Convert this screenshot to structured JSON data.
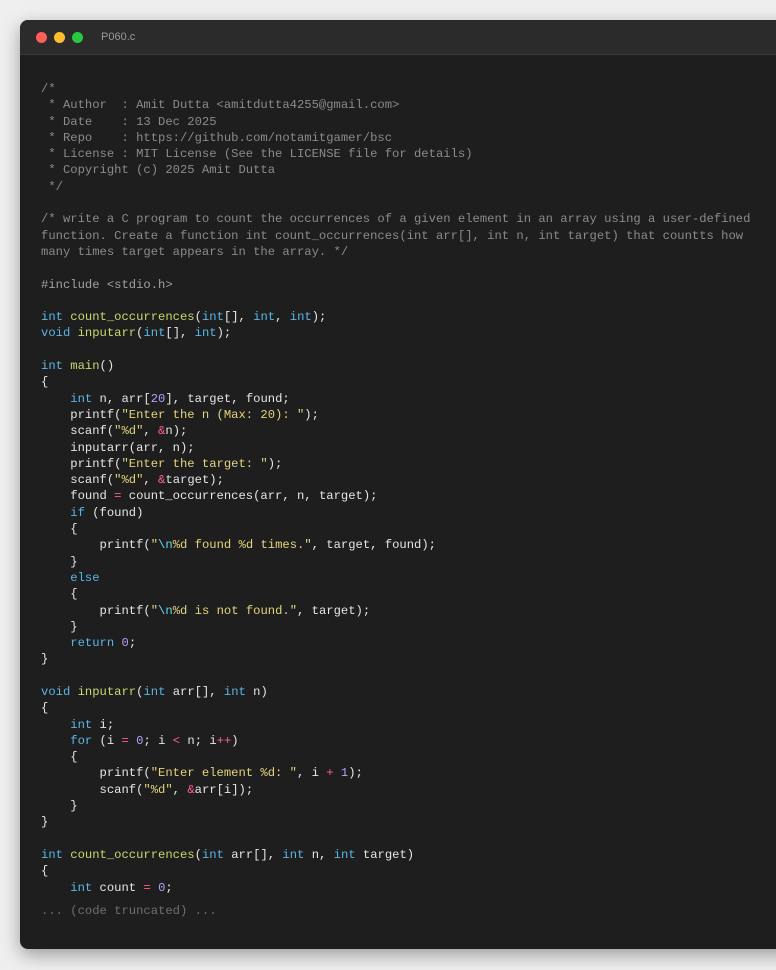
{
  "window": {
    "title": "P060.c",
    "controls": [
      "close",
      "minimize",
      "maximize"
    ]
  },
  "editor": {
    "truncated_note": "... (code truncated) ...",
    "lines": [
      [
        [
          "comment",
          "/*"
        ]
      ],
      [
        [
          "comment",
          " * Author  : Amit Dutta <amitdutta4255@gmail.com>"
        ]
      ],
      [
        [
          "comment",
          " * Date    : 13 Dec 2025"
        ]
      ],
      [
        [
          "comment",
          " * Repo    : https://github.com/notamitgamer/bsc"
        ]
      ],
      [
        [
          "comment",
          " * License : MIT License (See the LICENSE file for details)"
        ]
      ],
      [
        [
          "comment",
          " * Copyright (c) 2025 Amit Dutta"
        ]
      ],
      [
        [
          "comment",
          " */"
        ]
      ],
      [],
      [
        [
          "comment",
          "/* write a C program to count the occurrences of a given element in an array using a user-defined"
        ]
      ],
      [
        [
          "comment",
          "function. Create a function int count_occurrences(int arr[], int n, int target) that countts how"
        ]
      ],
      [
        [
          "comment",
          "many times target appears in the array. */"
        ]
      ],
      [],
      [
        [
          "preproc",
          "#include <stdio.h>"
        ]
      ],
      [],
      [
        [
          "keyword",
          "int"
        ],
        [
          "plain",
          " "
        ],
        [
          "func",
          "count_occurrences"
        ],
        [
          "plain",
          "("
        ],
        [
          "keyword",
          "int"
        ],
        [
          "plain",
          "[], "
        ],
        [
          "keyword",
          "int"
        ],
        [
          "plain",
          ", "
        ],
        [
          "keyword",
          "int"
        ],
        [
          "plain",
          ");"
        ]
      ],
      [
        [
          "keyword",
          "void"
        ],
        [
          "plain",
          " "
        ],
        [
          "func",
          "inputarr"
        ],
        [
          "plain",
          "("
        ],
        [
          "keyword",
          "int"
        ],
        [
          "plain",
          "[], "
        ],
        [
          "keyword",
          "int"
        ],
        [
          "plain",
          ");"
        ]
      ],
      [],
      [
        [
          "keyword",
          "int"
        ],
        [
          "plain",
          " "
        ],
        [
          "func",
          "main"
        ],
        [
          "plain",
          "()"
        ]
      ],
      [
        [
          "plain",
          "{"
        ]
      ],
      [
        [
          "plain",
          "    "
        ],
        [
          "keyword",
          "int"
        ],
        [
          "plain",
          " n, arr["
        ],
        [
          "number",
          "20"
        ],
        [
          "plain",
          "], target, found;"
        ]
      ],
      [
        [
          "plain",
          "    printf("
        ],
        [
          "string",
          "\"Enter the n (Max: 20): \""
        ],
        [
          "plain",
          ");"
        ]
      ],
      [
        [
          "plain",
          "    scanf("
        ],
        [
          "string",
          "\"%d\""
        ],
        [
          "plain",
          ", "
        ],
        [
          "op",
          "&"
        ],
        [
          "plain",
          "n);"
        ]
      ],
      [
        [
          "plain",
          "    inputarr(arr, n);"
        ]
      ],
      [
        [
          "plain",
          "    printf("
        ],
        [
          "string",
          "\"Enter the target: \""
        ],
        [
          "plain",
          ");"
        ]
      ],
      [
        [
          "plain",
          "    scanf("
        ],
        [
          "string",
          "\"%d\""
        ],
        [
          "plain",
          ", "
        ],
        [
          "op",
          "&"
        ],
        [
          "plain",
          "target);"
        ]
      ],
      [
        [
          "plain",
          "    found "
        ],
        [
          "op",
          "="
        ],
        [
          "plain",
          " count_occurrences(arr, n, target);"
        ]
      ],
      [
        [
          "plain",
          "    "
        ],
        [
          "keyword",
          "if"
        ],
        [
          "plain",
          " (found)"
        ]
      ],
      [
        [
          "plain",
          "    {"
        ]
      ],
      [
        [
          "plain",
          "        printf("
        ],
        [
          "string",
          "\""
        ],
        [
          "escape",
          "\\n"
        ],
        [
          "string",
          "%d found %d times.\""
        ],
        [
          "plain",
          ", target, found);"
        ]
      ],
      [
        [
          "plain",
          "    }"
        ]
      ],
      [
        [
          "plain",
          "    "
        ],
        [
          "keyword",
          "else"
        ]
      ],
      [
        [
          "plain",
          "    {"
        ]
      ],
      [
        [
          "plain",
          "        printf("
        ],
        [
          "string",
          "\""
        ],
        [
          "escape",
          "\\n"
        ],
        [
          "string",
          "%d is not found.\""
        ],
        [
          "plain",
          ", target);"
        ]
      ],
      [
        [
          "plain",
          "    }"
        ]
      ],
      [
        [
          "plain",
          "    "
        ],
        [
          "keyword",
          "return"
        ],
        [
          "plain",
          " "
        ],
        [
          "number",
          "0"
        ],
        [
          "plain",
          ";"
        ]
      ],
      [
        [
          "plain",
          "}"
        ]
      ],
      [],
      [
        [
          "keyword",
          "void"
        ],
        [
          "plain",
          " "
        ],
        [
          "func",
          "inputarr"
        ],
        [
          "plain",
          "("
        ],
        [
          "keyword",
          "int"
        ],
        [
          "plain",
          " arr[], "
        ],
        [
          "keyword",
          "int"
        ],
        [
          "plain",
          " n)"
        ]
      ],
      [
        [
          "plain",
          "{"
        ]
      ],
      [
        [
          "plain",
          "    "
        ],
        [
          "keyword",
          "int"
        ],
        [
          "plain",
          " i;"
        ]
      ],
      [
        [
          "plain",
          "    "
        ],
        [
          "keyword",
          "for"
        ],
        [
          "plain",
          " (i "
        ],
        [
          "op",
          "="
        ],
        [
          "plain",
          " "
        ],
        [
          "number",
          "0"
        ],
        [
          "plain",
          "; i "
        ],
        [
          "op",
          "<"
        ],
        [
          "plain",
          " n; i"
        ],
        [
          "op",
          "++"
        ],
        [
          "plain",
          ")"
        ]
      ],
      [
        [
          "plain",
          "    {"
        ]
      ],
      [
        [
          "plain",
          "        printf("
        ],
        [
          "string",
          "\"Enter element %d: \""
        ],
        [
          "plain",
          ", i "
        ],
        [
          "op",
          "+"
        ],
        [
          "plain",
          " "
        ],
        [
          "number",
          "1"
        ],
        [
          "plain",
          ");"
        ]
      ],
      [
        [
          "plain",
          "        scanf("
        ],
        [
          "string",
          "\"%d\""
        ],
        [
          "plain",
          ", "
        ],
        [
          "op",
          "&"
        ],
        [
          "plain",
          "arr[i]);"
        ]
      ],
      [
        [
          "plain",
          "    }"
        ]
      ],
      [
        [
          "plain",
          "}"
        ]
      ],
      [],
      [
        [
          "keyword",
          "int"
        ],
        [
          "plain",
          " "
        ],
        [
          "func",
          "count_occurrences"
        ],
        [
          "plain",
          "("
        ],
        [
          "keyword",
          "int"
        ],
        [
          "plain",
          " arr[], "
        ],
        [
          "keyword",
          "int"
        ],
        [
          "plain",
          " n, "
        ],
        [
          "keyword",
          "int"
        ],
        [
          "plain",
          " target)"
        ]
      ],
      [
        [
          "plain",
          "{"
        ]
      ],
      [
        [
          "plain",
          "    "
        ],
        [
          "keyword",
          "int"
        ],
        [
          "plain",
          " count "
        ],
        [
          "op",
          "="
        ],
        [
          "plain",
          " "
        ],
        [
          "number",
          "0"
        ],
        [
          "plain",
          ";"
        ]
      ]
    ]
  }
}
